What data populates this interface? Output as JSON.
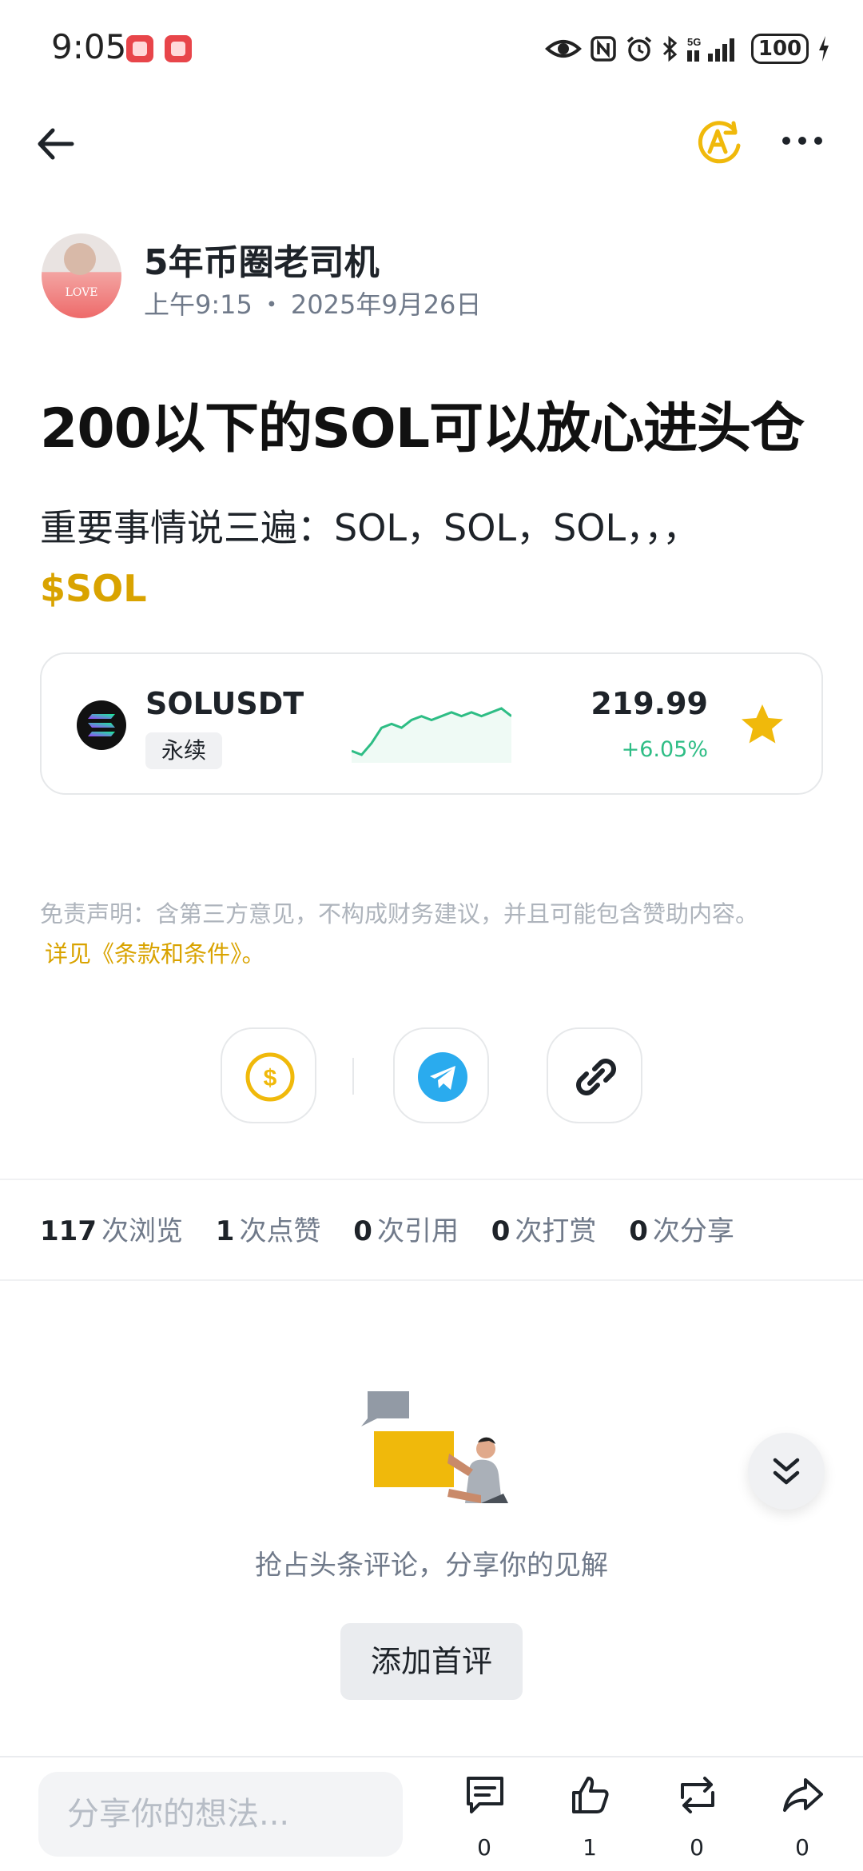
{
  "status_bar": {
    "time": "9:05",
    "battery": "100",
    "network": "5G"
  },
  "header": {
    "back_icon": "arrow-left-icon",
    "translate_icon": "translate-icon",
    "more_icon": "more-icon",
    "accent_color": "#F0B90B"
  },
  "author": {
    "name": "5年币圈老司机",
    "time": "上午9:15",
    "separator": "・",
    "date": "2025年9月26日",
    "avatar_text": "LOVE"
  },
  "post": {
    "title": "200以下的SOL可以放心进头仓",
    "body": "重要事情说三遍：SOL，SOL，SOL，，，",
    "cashtag": "$SOL"
  },
  "ticker": {
    "symbol": "SOLUSDT",
    "tag": "永续",
    "price": "219.99",
    "change": "+6.05%",
    "change_color": "#2EBD85",
    "sparkline": [
      3,
      2,
      5,
      9,
      10,
      9,
      11,
      12,
      11,
      12,
      13,
      12,
      13,
      12,
      13,
      14,
      12
    ],
    "favorite_icon": "star-icon"
  },
  "disclaimer": {
    "text": "免责声明：含第三方意见，不构成财务建议，并且可能包含赞助内容。",
    "link": "详见《条款和条件》。"
  },
  "share": {
    "tip_icon": "tip-dollar-icon",
    "telegram_icon": "telegram-icon",
    "link_icon": "link-icon"
  },
  "stats": [
    {
      "num": "117",
      "label": "次浏览"
    },
    {
      "num": "1",
      "label": "次点赞"
    },
    {
      "num": "0",
      "label": "次引用"
    },
    {
      "num": "0",
      "label": "次打赏"
    },
    {
      "num": "0",
      "label": "次分享"
    }
  ],
  "comments": {
    "empty_text": "抢占头条评论，分享你的见解",
    "first_comment_button": "添加首评"
  },
  "bottom_bar": {
    "input_placeholder": "分享你的想法...",
    "comment_count": "0",
    "like_count": "1",
    "repost_count": "0",
    "share_count": "0"
  }
}
